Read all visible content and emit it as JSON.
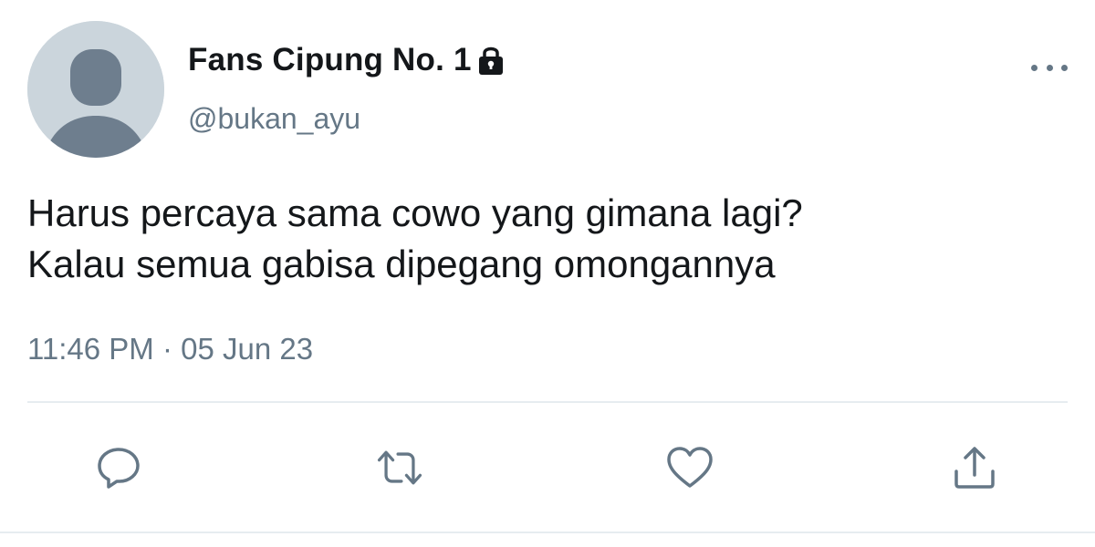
{
  "user": {
    "display_name": "Fans Cipung No. 1",
    "handle": "@bukan_ayu",
    "protected_icon": "lock-icon",
    "avatar": "default-avatar"
  },
  "tweet": {
    "text": "Harus percaya sama cowo yang gimana lagi?\nKalau semua gabisa dipegang omongannya",
    "time": "11:46 PM",
    "separator": "·",
    "date": "05 Jun 23"
  },
  "actions": [
    {
      "name": "reply",
      "icon": "speech-bubble-icon"
    },
    {
      "name": "retweet",
      "icon": "retweet-arrows-icon"
    },
    {
      "name": "like",
      "icon": "heart-icon"
    },
    {
      "name": "share",
      "icon": "share-upload-icon"
    }
  ],
  "menu": {
    "icon": "more-horizontal-icon"
  },
  "colors": {
    "text_primary": "#14171a",
    "text_secondary": "#657786",
    "avatar_bg": "#cbd5dc",
    "avatar_figure": "#6e7e8e",
    "action_icon": "#657786",
    "divider": "#e6ecf0"
  }
}
